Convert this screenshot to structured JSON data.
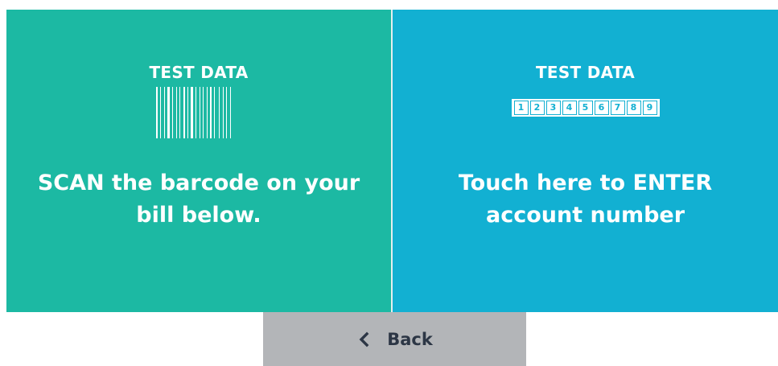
{
  "colors": {
    "scan_panel": "#1cb9a3",
    "enter_panel": "#12b0d2",
    "back_button": "#b3b5b8",
    "back_text": "#2c3645"
  },
  "scan_panel": {
    "test_label": "TEST DATA",
    "icon": "barcode-icon",
    "message_line1": "SCAN the barcode on your",
    "message_line2": "bill below."
  },
  "enter_panel": {
    "test_label": "TEST DATA",
    "digits": [
      "1",
      "2",
      "3",
      "4",
      "5",
      "6",
      "7",
      "8",
      "9"
    ],
    "message_line1": "Touch here to ENTER",
    "message_line2": "account number"
  },
  "back_button": {
    "icon": "chevron-left-icon",
    "label": "Back"
  }
}
